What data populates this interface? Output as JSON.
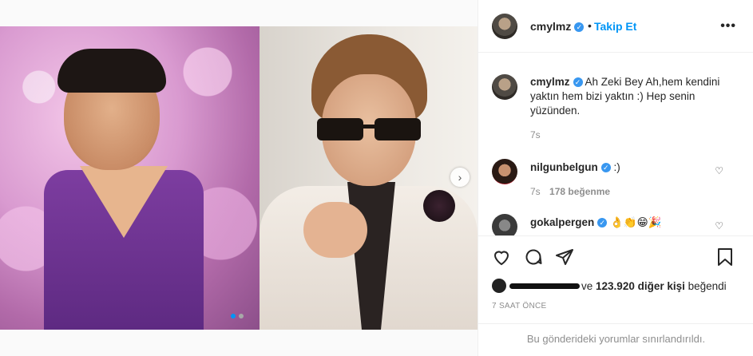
{
  "header": {
    "username": "cmylmz",
    "separator": "•",
    "follow_label": "Takip Et",
    "more_label": "•••"
  },
  "caption": {
    "username": "cmylmz",
    "text": "Ah Zeki Bey Ah,hem kendini yaktın hem bizi yaktın :) Hep senin yüzünden.",
    "time": "7s"
  },
  "comments": [
    {
      "username": "nilgunbelgun",
      "text": ":)",
      "time": "7s",
      "likes": "178 beğenme"
    },
    {
      "username": "gokalpergen",
      "text": "👌👏😁🎉"
    }
  ],
  "media": {
    "next_icon": "chevron-right-icon",
    "next_label": "›",
    "slide_count": 2,
    "active_slide": 1
  },
  "actions": {
    "like_icon": "heart-icon",
    "comment_icon": "comment-icon",
    "share_icon": "share-icon",
    "save_icon": "bookmark-icon"
  },
  "likes": {
    "prefix": "ve",
    "count": "123.920 diğer kişi",
    "suffix": "beğendi"
  },
  "post_time": "7 SAAT ÖNCE",
  "comments_limited": "Bu gönderideki yorumlar sınırlandırıldı.",
  "colors": {
    "accent": "#0095f6",
    "verified": "#3897f0",
    "muted": "#8e8e8e"
  }
}
